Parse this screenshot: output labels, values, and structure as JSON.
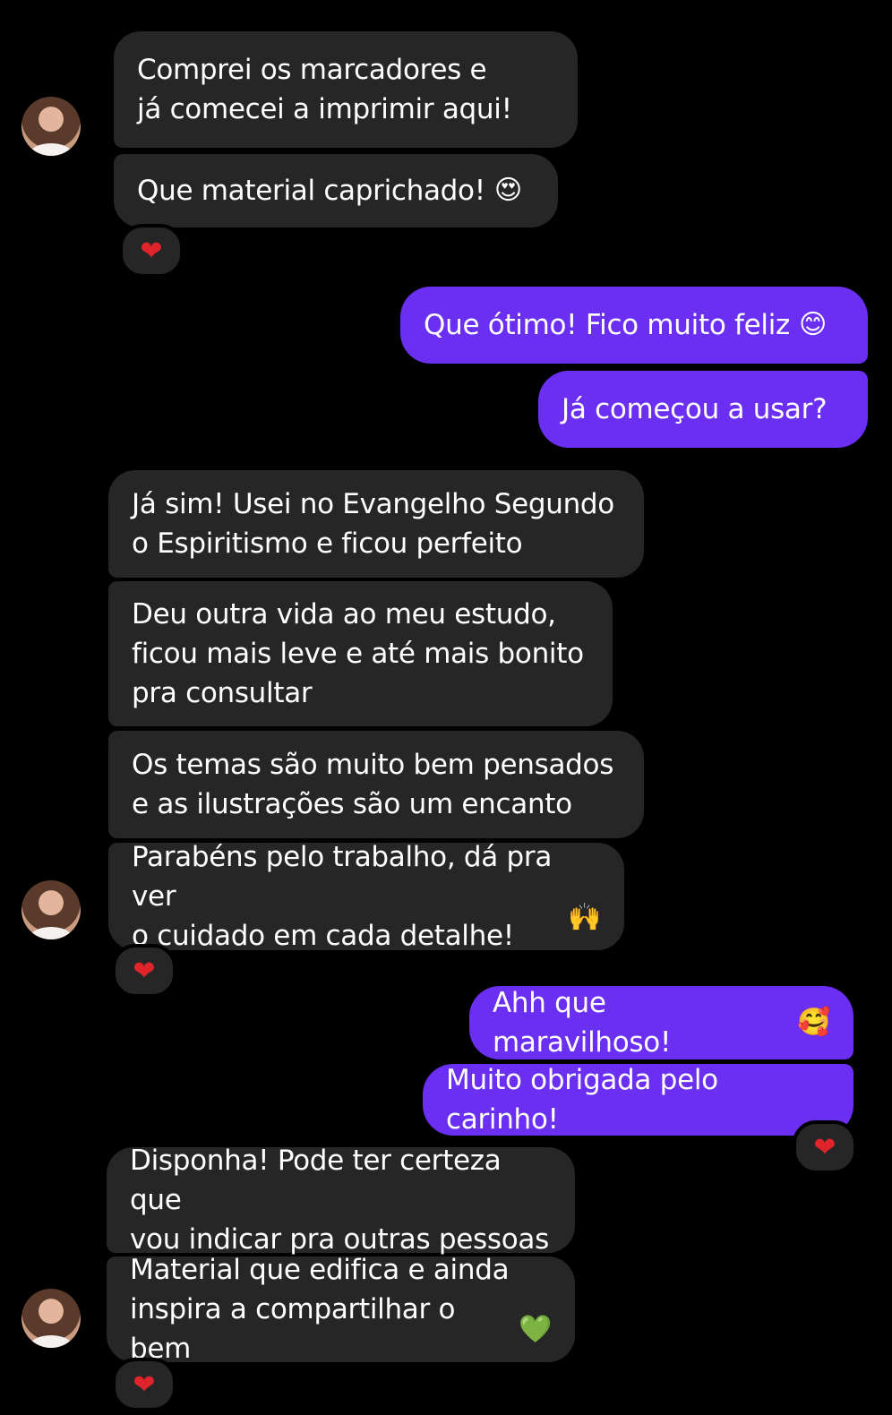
{
  "messages": [
    {
      "text": "Comprei os marcadores e\njá comecei a imprimir aqui!"
    },
    {
      "text": "Que material caprichado!",
      "emoji": "😍"
    },
    {
      "text": "Que ótimo! Fico muito feliz",
      "emoji": "😊"
    },
    {
      "text": "Já começou a usar?"
    },
    {
      "text": "Já sim! Usei no Evangelho Segundo\no Espiritismo e ficou perfeito"
    },
    {
      "text": "Deu outra vida ao meu estudo,\nficou mais leve e até mais bonito\npra consultar"
    },
    {
      "text": "Os temas são muito bem pensados\ne as ilustrações são um encanto"
    },
    {
      "text": "Parabéns pelo trabalho, dá pra ver\no cuidado em cada detalhe!",
      "emoji": "🙌"
    },
    {
      "text": "Ahh que maravilhoso!",
      "emoji": "🥰"
    },
    {
      "text": "Muito obrigada pelo carinho!"
    },
    {
      "text": "Disponha! Pode ter certeza que\nvou indicar pra outras pessoas"
    },
    {
      "text": "Material que edifica e ainda\ninspira a compartilhar o bem",
      "emoji": "💚"
    }
  ],
  "reaction_emoji": "❤",
  "colors": {
    "incoming_bubble": "#262626",
    "outgoing_bubble": "#6b2ff2",
    "background": "#000000",
    "reaction_heart": "#e0242b"
  }
}
